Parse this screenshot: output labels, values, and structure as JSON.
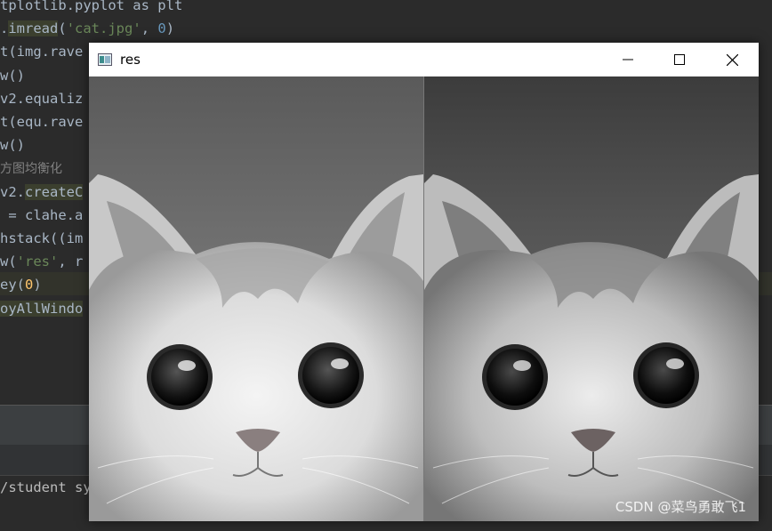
{
  "editor": {
    "lines": [
      {
        "segments": [
          {
            "t": "tplotlib.pyplot as plt"
          }
        ]
      },
      {
        "segments": [
          {
            "t": ".",
            "c": ""
          },
          {
            "t": "imread",
            "c": "k-hl"
          },
          {
            "t": "("
          },
          {
            "t": "'cat.jpg'",
            "c": "k-str"
          },
          {
            "t": ", "
          },
          {
            "t": "0",
            "c": "k-num"
          },
          {
            "t": ")"
          }
        ]
      },
      {
        "segments": [
          {
            "t": "t(img.rave"
          }
        ]
      },
      {
        "segments": [
          {
            "t": "w()"
          }
        ]
      },
      {
        "segments": [
          {
            "t": "v2.equaliz"
          }
        ]
      },
      {
        "segments": [
          {
            "t": "t(equ.rave"
          }
        ]
      },
      {
        "segments": [
          {
            "t": "w()"
          }
        ]
      },
      {
        "segments": [
          {
            "t": "方图均衡化",
            "c": "k-cmt"
          }
        ]
      },
      {
        "segments": [
          {
            "t": "v2."
          },
          {
            "t": "createC",
            "c": "k-hl"
          }
        ]
      },
      {
        "segments": [
          {
            "t": " = clahe.a"
          }
        ]
      },
      {
        "segments": [
          {
            "t": "hstack((im"
          }
        ]
      },
      {
        "segments": [
          {
            "t": "w("
          },
          {
            "t": "'res'",
            "c": "k-str"
          },
          {
            "t": ", r"
          }
        ]
      },
      {
        "segments": [
          {
            "t": "ey("
          },
          {
            "t": "0",
            "c": "k-yel"
          },
          {
            "t": ")"
          }
        ]
      },
      {
        "segments": [
          {
            "t": "oyAllWindo",
            "c": "k-hl"
          }
        ]
      }
    ]
  },
  "console": {
    "text": "/student sy"
  },
  "window": {
    "title": "res",
    "minimize_icon": "minimize-icon",
    "maximize_icon": "maximize-icon",
    "close_icon": "close-icon",
    "watermark": "CSDN @菜鸟勇敢飞1"
  }
}
